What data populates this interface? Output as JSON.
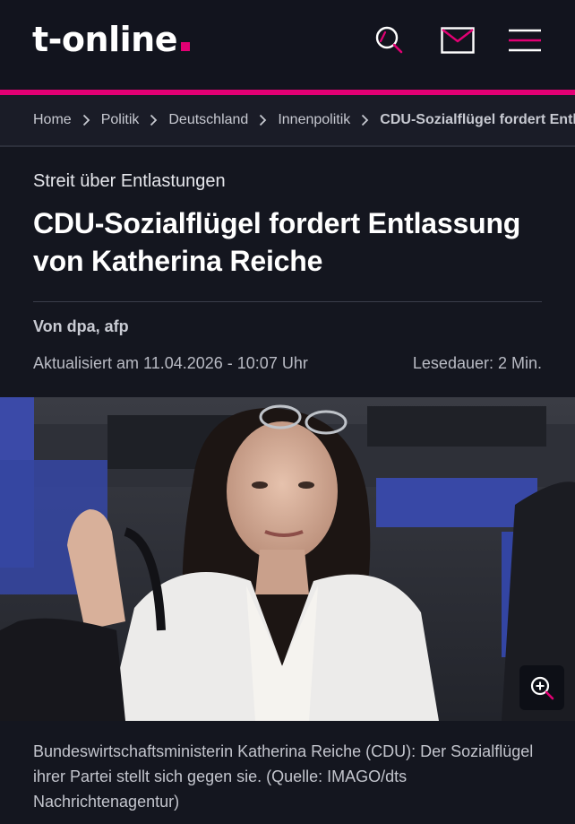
{
  "header": {
    "logo_text": "t-online",
    "logo_dot_color": "#e20074",
    "search_icon": "search-icon",
    "mail_icon": "mail-icon",
    "menu_icon": "hamburger-menu-icon"
  },
  "breadcrumb": {
    "items": [
      {
        "label": "Home"
      },
      {
        "label": "Politik"
      },
      {
        "label": "Deutschland"
      },
      {
        "label": "Innenpolitik"
      },
      {
        "label": "CDU-Sozialflügel fordert Entlassung von Katherina Reiche"
      }
    ],
    "separator_icon": "chevron-right-icon"
  },
  "article": {
    "kicker": "Streit über Entlastungen",
    "headline": "CDU-Sozialflügel fordert Entlassung von Katherina Reiche",
    "author": "Von dpa, afp",
    "updated": "Aktualisiert am 11.04.2026 - 10:07 Uhr",
    "reading_time": "Lesedauer: 2 Min.",
    "image": {
      "zoom_icon": "zoom-in-icon",
      "caption": "Bundeswirtschaftsministerin Katherina Reiche (CDU): Der Sozialflügel ihrer Partei stellt sich gegen sie. (Quelle: IMAGO/dts Nachrichtenagentur)"
    }
  },
  "colors": {
    "background": "#14161f",
    "accent": "#e20074",
    "breadcrumb_bg": "#1a1c27"
  }
}
